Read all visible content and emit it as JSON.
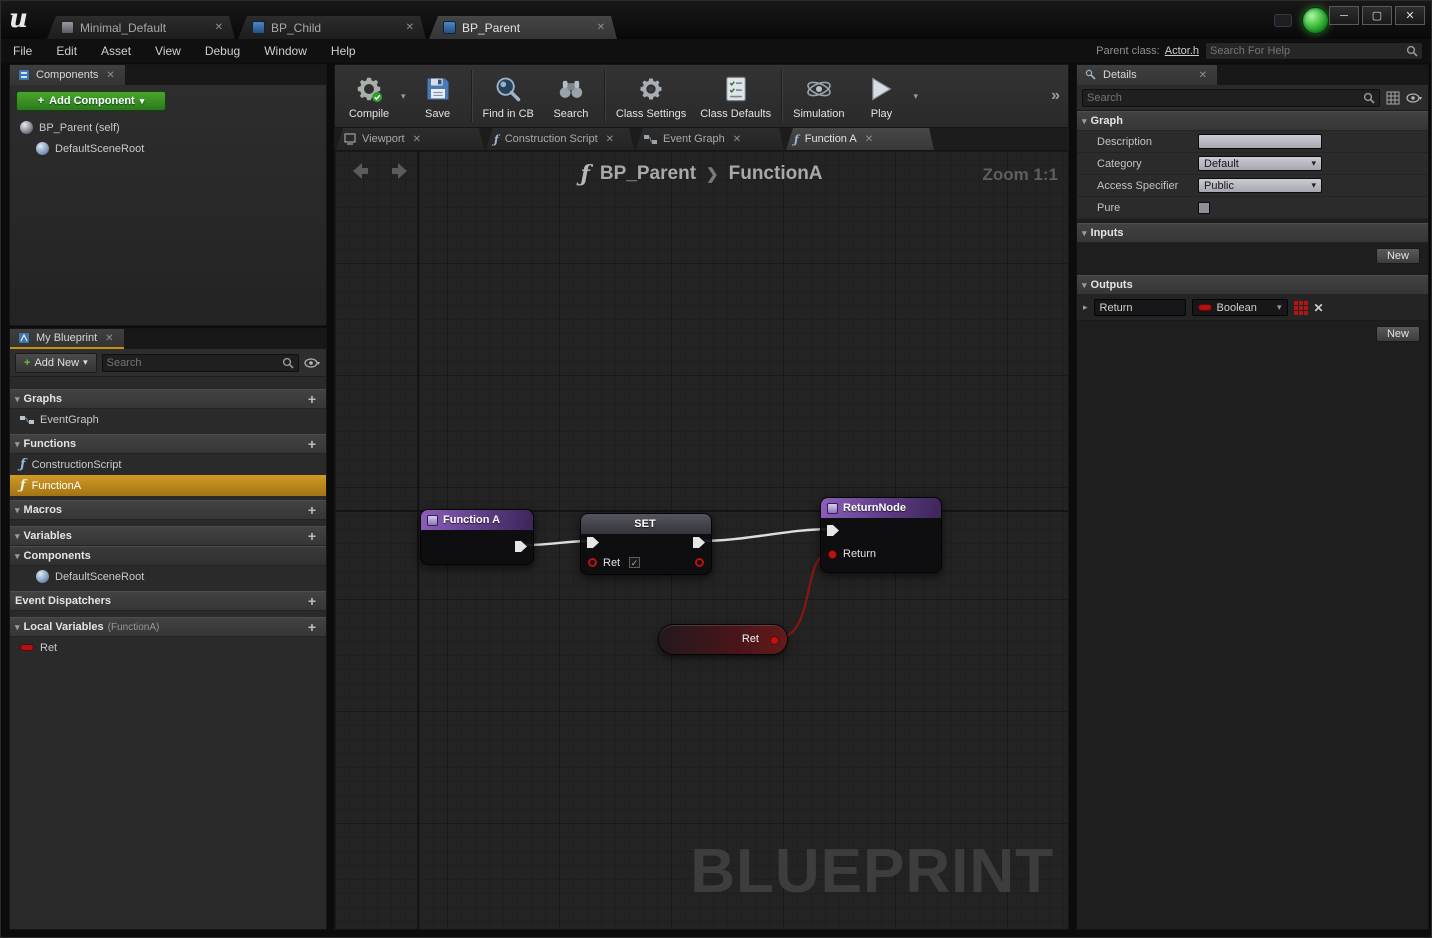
{
  "glyphs": {
    "close": "✕",
    "minimize": "─",
    "maximize": "▢",
    "caret": "▾",
    "plus": "+",
    "expand": "▸",
    "collapse": "▾",
    "chevrons": "»",
    "breadcrumb_sep": "❯",
    "fnof": "ƒ",
    "check": "✓"
  },
  "titlebar": {
    "tabs": [
      {
        "label": "Minimal_Default"
      },
      {
        "label": "BP_Child"
      },
      {
        "label": "BP_Parent"
      }
    ]
  },
  "menubar": {
    "items": [
      "File",
      "Edit",
      "Asset",
      "View",
      "Debug",
      "Window",
      "Help"
    ],
    "parent_class_label": "Parent class:",
    "parent_class_value": "Actor.h",
    "help_search_placeholder": "Search For Help"
  },
  "components_panel": {
    "tab_label": "Components",
    "add_component_label": "Add Component",
    "items": [
      {
        "label": "BP_Parent (self)"
      },
      {
        "label": "DefaultSceneRoot"
      }
    ]
  },
  "my_blueprint": {
    "tab_label": "My Blueprint",
    "add_new_label": "Add New",
    "search_placeholder": "Search",
    "graphs_header": "Graphs",
    "eventgraph_label": "EventGraph",
    "functions_header": "Functions",
    "construction_script_label": "ConstructionScript",
    "functiona_label": "FunctionA",
    "macros_header": "Macros",
    "variables_header": "Variables",
    "components_header": "Components",
    "default_scene_root_label": "DefaultSceneRoot",
    "event_dispatchers_header": "Event Dispatchers",
    "local_variables_header": "Local Variables",
    "local_variables_context": "(FunctionA)",
    "ret_label": "Ret"
  },
  "toolbar": {
    "compile": "Compile",
    "save": "Save",
    "find_in_cb": "Find in CB",
    "search": "Search",
    "class_settings": "Class Settings",
    "class_defaults": "Class Defaults",
    "simulation": "Simulation",
    "play": "Play"
  },
  "graph_tabs": [
    {
      "label": "Viewport"
    },
    {
      "label": "Construction Script"
    },
    {
      "label": "Event Graph"
    },
    {
      "label": "Function A"
    }
  ],
  "graph": {
    "breadcrumb_parent": "BP_Parent",
    "breadcrumb_child": "FunctionA",
    "zoom_label": "Zoom 1:1",
    "watermark": "BLUEPRINT",
    "nodes": {
      "function_a": {
        "title": "Function A"
      },
      "set": {
        "title": "SET",
        "pin_label": "Ret"
      },
      "return_node": {
        "title": "ReturnNode",
        "pin_label": "Return"
      },
      "ret_getter": {
        "label": "Ret"
      }
    }
  },
  "details": {
    "tab_label": "Details",
    "search_placeholder": "Search",
    "graph_section": {
      "header": "Graph",
      "description_label": "Description",
      "category_label": "Category",
      "category_value": "Default",
      "access_specifier_label": "Access Specifier",
      "access_specifier_value": "Public",
      "pure_label": "Pure"
    },
    "inputs_section": {
      "header": "Inputs",
      "new_button": "New"
    },
    "outputs_section": {
      "header": "Outputs",
      "row_name": "Return",
      "row_type": "Boolean",
      "new_button": "New"
    }
  },
  "colors": {
    "accent_orange": "#c8871e",
    "green_button": "#2f9e2f",
    "node_purple": "#7b4fa5",
    "pin_red": "#b51212",
    "exec_white": "#e0e0e0",
    "blueprint_blue": "#2d6da8"
  }
}
